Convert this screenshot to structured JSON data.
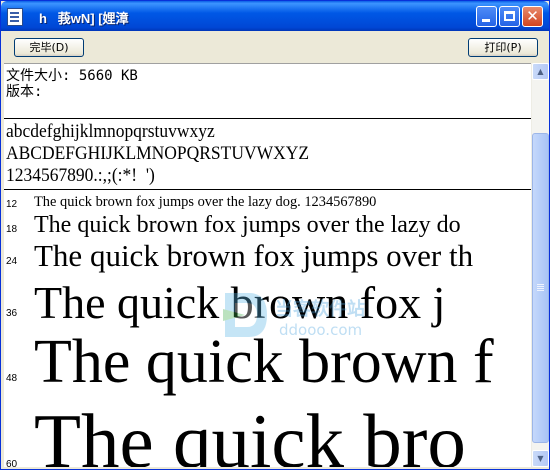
{
  "window": {
    "title": "h   莪wN] [娌漳",
    "close_glyph": "✕"
  },
  "toolbar": {
    "done_label": "完毕(D)",
    "print_label": "打印(P)"
  },
  "info": {
    "file_size": "文件大小: 5660 KB",
    "version": "版本:"
  },
  "charset": {
    "lower": "abcdefghijklmnopqrstuvwxyz",
    "upper": "ABCDEFGHIJKLMNOPQRSTUVWXYZ",
    "digits": "1234567890.:,;(:*!  ')"
  },
  "samples": [
    {
      "size": "12",
      "text": "The quick brown fox jumps over the lazy dog. 1234567890"
    },
    {
      "size": "18",
      "text": "The quick brown fox jumps over the lazy do"
    },
    {
      "size": "24",
      "text": "The quick brown fox jumps over th"
    },
    {
      "size": "36",
      "text": "The quick brown fox j"
    },
    {
      "size": "48",
      "text": "The quick brown f"
    },
    {
      "size": "60",
      "text": "The quick bro"
    }
  ],
  "watermark": {
    "name": "当客软件站",
    "url": "ddooo.com"
  }
}
